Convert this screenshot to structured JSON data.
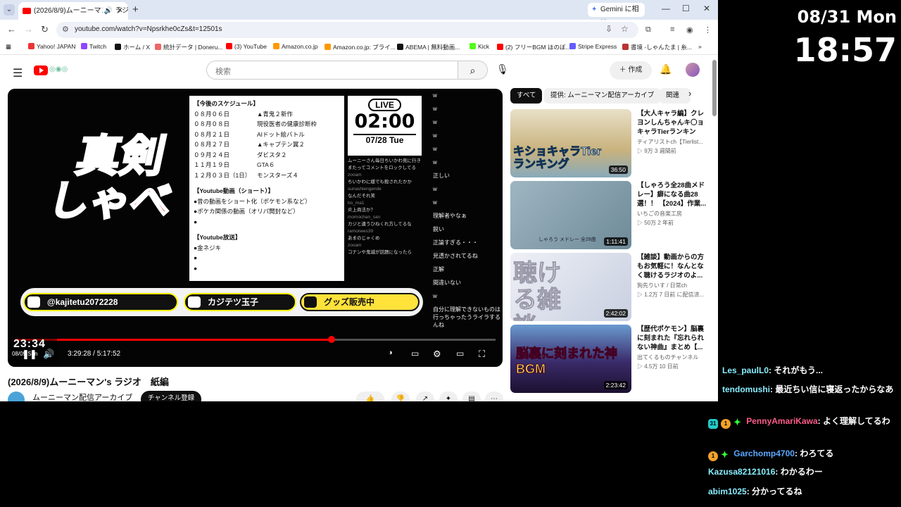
{
  "browser": {
    "tab_title": "(2026/8/9)ムーニーマン's ラジオ",
    "gemini_label": "Gemini に相談",
    "url": "youtube.com/watch?v=Npsrkhe0cZs&t=12501s"
  },
  "bookmarks": [
    {
      "label": "Yahoo! JAPAN",
      "color": "#e33"
    },
    {
      "label": "Twitch",
      "color": "#9146ff"
    },
    {
      "label": "ホーム / X",
      "color": "#111"
    },
    {
      "label": "統計データ | Doneru...",
      "color": "#e66"
    },
    {
      "label": "(3) YouTube",
      "color": "#f00"
    },
    {
      "label": "Amazon.co.jp",
      "color": "#f90"
    },
    {
      "label": "Amazon.co.jp: プライ...",
      "color": "#f90"
    },
    {
      "label": "ABEMA | 無料動画...",
      "color": "#111"
    },
    {
      "label": "Kick",
      "color": "#53fc18"
    },
    {
      "label": "(2) フリーBGM ほのぼ...",
      "color": "#f00"
    },
    {
      "label": "Stripe Express",
      "color": "#635bff"
    },
    {
      "label": "書境 -しゃんたま | 糸...",
      "color": "#b33"
    }
  ],
  "youtube": {
    "search_placeholder": "検索",
    "create_label": "作成",
    "video": {
      "title": "(2026/8/9)ムーニーマン's ラジオ　紙編",
      "channel": "ムーニーマン配信アーカイブ",
      "subscribe_label": "チャンネル登録",
      "current_time": "3:29:28",
      "duration": "5:17:52",
      "progress": 0.659,
      "clock_overlay": "23:34",
      "clock_date": "08/09 Sun"
    },
    "frame": {
      "headline_1": "真剣",
      "headline_2": "しゃべ",
      "schedule_title": "【今後のスケジュール】",
      "schedule": [
        {
          "date": "０８月０６日",
          "event": "▲青鬼２新作"
        },
        {
          "date": "０８月０８日",
          "event": "現役医者の健康診断枠"
        },
        {
          "date": "０８月２１日",
          "event": "AIドット絵バトル"
        },
        {
          "date": "０８月２７日",
          "event": "▲キャプテン翼２"
        },
        {
          "date": "０９月２４日",
          "event": "ダビスタ２"
        },
        {
          "date": "１１月１９日",
          "event": "GTA６"
        },
        {
          "date": "１２月０３日（1日）",
          "event": "モンスターズ４"
        }
      ],
      "shorts_title": "【Youtube動画（ショート）】",
      "shorts": [
        "●昔の動画をショート化（ポケモン系など）",
        "●ポケカ関係の動画（オリパ開封など）",
        "●"
      ],
      "broadcast_title": "【Youtube放送】",
      "broadcast": [
        "●金ネジキ",
        "●",
        "●"
      ],
      "live_label": "LIVE",
      "live_time": "02:00",
      "live_date": "07/28 Tue",
      "stream_chat": [
        {
          "name": "",
          "msg": "ムーニーさん毎日ちいかわ見に行きまたってコメントをロックしてる"
        },
        {
          "name": "zooam",
          "msg": "ちいかわに緩でも殺されたかか"
        },
        {
          "name": "sunashiengende",
          "msg": "なんだそれ笑"
        },
        {
          "name": "bo_ma1",
          "msg": "炎上商法か？"
        },
        {
          "name": "momochan_san",
          "msg": "カジと違うひねくれ方してるな"
        },
        {
          "name": "ramonees39",
          "msg": "あまのじゃくめ"
        },
        {
          "name": "zooam",
          "msg": "コナンや鬼滅が話題になったら"
        }
      ],
      "banner_twitter": "@kajitetu2072228",
      "banner_youtube": "カジテツ玉子",
      "banner_goods": "グッズ販売中",
      "overlay_chat": [
        "w",
        "w",
        "w",
        "w",
        "w",
        "w",
        "正しい",
        "w",
        "w",
        "理解者やなぁ",
        "鋭い",
        "正論すぎる・・・",
        "見透かされてるね",
        "正解",
        "間違いない",
        "w",
        "自分に理解できないものは行っちゃったうライラするんね"
      ]
    },
    "chips": [
      "すべて",
      "提供: ムーニーマン配信アーカイブ",
      "関連"
    ],
    "recommendations": [
      {
        "title": "【大人キャラ編】クレヨンしんちゃんキ〇ョキャラTierランキング...",
        "channel": "ティアリストch【Tierlist...",
        "meta": "▷ 9万  3 週間前",
        "duration": "36:50",
        "thumb": "#c9b27d",
        "thumb_text": "キショキャラTierランキング"
      },
      {
        "title": "【しゃろう全28曲メドレー】癖になる曲28選！！ 【2024】作業...",
        "channel": "いちごの音楽工房",
        "meta": "▷ 50万  2 年前",
        "duration": "1:11:41",
        "thumb": "#7f9aa8",
        "thumb_text": "しゃろう メドレー 全28曲"
      },
      {
        "title": "【雑談】動画からの方もお気軽に！なんとなく聴けるラジオのよ...",
        "channel": "狗先りいす / 日常ch",
        "meta": "▷ 1.2万  7 日前 に配信済...",
        "duration": "2:42:02",
        "thumb": "#dfe3ec",
        "thumb_text": "聴ける雑談"
      },
      {
        "title": "【歴代ポケモン】脳裏に刻まれた『忘れられない神曲』まとめ【...",
        "channel": "出てくるものチャンネル",
        "meta": "▷ 4.5万  10 日前",
        "duration": "2:23:42",
        "thumb": "#3a2a6a",
        "thumb_text": "脳裏に刻まれた神BGM"
      }
    ]
  },
  "widget": {
    "date": "08/31 Mon",
    "time": "18:57"
  },
  "livechat": [
    {
      "user": "Les_paulL0",
      "msg": "それがもう...",
      "badges": []
    },
    {
      "user": "tendomushi",
      "msg": "最近ちい信に寝返ったからなあ",
      "badges": []
    },
    {
      "user": "PennyAmariKawa",
      "msg": "よく理解してるわ",
      "badges": [
        "31",
        "1",
        "✦"
      ],
      "color": "#ff5a8a"
    },
    {
      "user": "Garchomp4700",
      "msg": "わろてる",
      "badges": [
        "1",
        "✦"
      ],
      "color": "#5aa8ff"
    },
    {
      "user": "Kazusa82121016",
      "msg": "わかるわー",
      "badges": [],
      "color": "#7bf"
    },
    {
      "user": "abim1025",
      "msg": "分かってるね",
      "badges": [],
      "color": "#7bf"
    }
  ]
}
